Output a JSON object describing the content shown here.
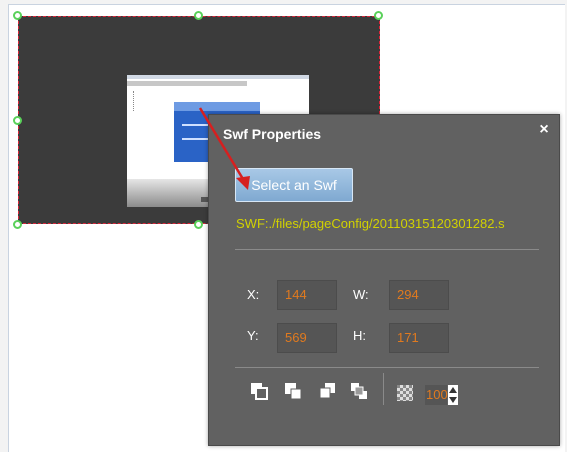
{
  "panel": {
    "title": "Swf Properties",
    "close_label": "×",
    "select_button_label": "Select an Swf",
    "swf_path": "SWF:./files/pageConfig/20110315120301282.s"
  },
  "position": {
    "x_label": "X:",
    "x_value": "144",
    "y_label": "Y:",
    "y_value": "569",
    "w_label": "W:",
    "w_value": "294",
    "h_label": "H:",
    "h_value": "171"
  },
  "toolbar": {
    "icons": [
      "bring-to-front-icon",
      "send-to-back-icon",
      "bring-forward-icon",
      "send-backward-icon",
      "opacity-icon"
    ],
    "opacity_value": "100"
  },
  "colors": {
    "panel_bg": "#616161",
    "value_text": "#e07a1f",
    "path_text": "#d2d200",
    "selection_border": "#d9263a",
    "handle": "#5ad15a"
  }
}
